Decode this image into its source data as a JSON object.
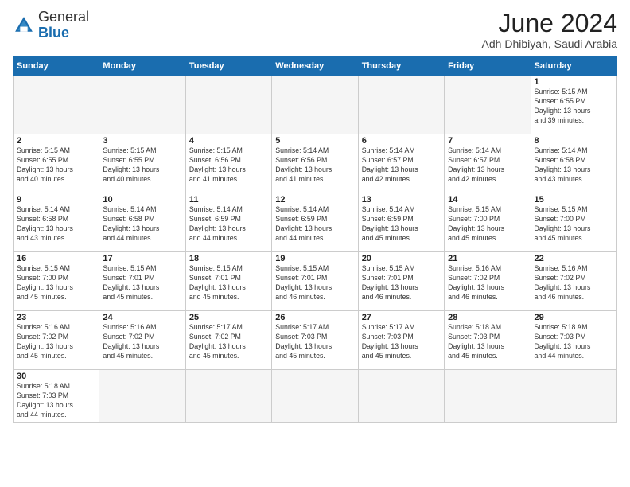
{
  "header": {
    "logo_general": "General",
    "logo_blue": "Blue",
    "month_title": "June 2024",
    "subtitle": "Adh Dhibiyah, Saudi Arabia"
  },
  "weekdays": [
    "Sunday",
    "Monday",
    "Tuesday",
    "Wednesday",
    "Thursday",
    "Friday",
    "Saturday"
  ],
  "days": [
    {
      "date": "",
      "empty": true
    },
    {
      "date": "",
      "empty": true
    },
    {
      "date": "",
      "empty": true
    },
    {
      "date": "",
      "empty": true
    },
    {
      "date": "",
      "empty": true
    },
    {
      "date": "",
      "empty": true
    },
    {
      "date": "1",
      "sunrise": "5:15 AM",
      "sunset": "6:55 PM",
      "daylight": "13 hours and 39 minutes."
    },
    {
      "date": "2",
      "sunrise": "5:15 AM",
      "sunset": "6:55 PM",
      "daylight": "13 hours and 40 minutes."
    },
    {
      "date": "3",
      "sunrise": "5:15 AM",
      "sunset": "6:55 PM",
      "daylight": "13 hours and 40 minutes."
    },
    {
      "date": "4",
      "sunrise": "5:15 AM",
      "sunset": "6:56 PM",
      "daylight": "13 hours and 41 minutes."
    },
    {
      "date": "5",
      "sunrise": "5:14 AM",
      "sunset": "6:56 PM",
      "daylight": "13 hours and 41 minutes."
    },
    {
      "date": "6",
      "sunrise": "5:14 AM",
      "sunset": "6:57 PM",
      "daylight": "13 hours and 42 minutes."
    },
    {
      "date": "7",
      "sunrise": "5:14 AM",
      "sunset": "6:57 PM",
      "daylight": "13 hours and 42 minutes."
    },
    {
      "date": "8",
      "sunrise": "5:14 AM",
      "sunset": "6:58 PM",
      "daylight": "13 hours and 43 minutes."
    },
    {
      "date": "9",
      "sunrise": "5:14 AM",
      "sunset": "6:58 PM",
      "daylight": "13 hours and 43 minutes."
    },
    {
      "date": "10",
      "sunrise": "5:14 AM",
      "sunset": "6:58 PM",
      "daylight": "13 hours and 44 minutes."
    },
    {
      "date": "11",
      "sunrise": "5:14 AM",
      "sunset": "6:59 PM",
      "daylight": "13 hours and 44 minutes."
    },
    {
      "date": "12",
      "sunrise": "5:14 AM",
      "sunset": "6:59 PM",
      "daylight": "13 hours and 44 minutes."
    },
    {
      "date": "13",
      "sunrise": "5:14 AM",
      "sunset": "6:59 PM",
      "daylight": "13 hours and 45 minutes."
    },
    {
      "date": "14",
      "sunrise": "5:15 AM",
      "sunset": "7:00 PM",
      "daylight": "13 hours and 45 minutes."
    },
    {
      "date": "15",
      "sunrise": "5:15 AM",
      "sunset": "7:00 PM",
      "daylight": "13 hours and 45 minutes."
    },
    {
      "date": "16",
      "sunrise": "5:15 AM",
      "sunset": "7:00 PM",
      "daylight": "13 hours and 45 minutes."
    },
    {
      "date": "17",
      "sunrise": "5:15 AM",
      "sunset": "7:01 PM",
      "daylight": "13 hours and 45 minutes."
    },
    {
      "date": "18",
      "sunrise": "5:15 AM",
      "sunset": "7:01 PM",
      "daylight": "13 hours and 45 minutes."
    },
    {
      "date": "19",
      "sunrise": "5:15 AM",
      "sunset": "7:01 PM",
      "daylight": "13 hours and 46 minutes."
    },
    {
      "date": "20",
      "sunrise": "5:15 AM",
      "sunset": "7:01 PM",
      "daylight": "13 hours and 46 minutes."
    },
    {
      "date": "21",
      "sunrise": "5:16 AM",
      "sunset": "7:02 PM",
      "daylight": "13 hours and 46 minutes."
    },
    {
      "date": "22",
      "sunrise": "5:16 AM",
      "sunset": "7:02 PM",
      "daylight": "13 hours and 46 minutes."
    },
    {
      "date": "23",
      "sunrise": "5:16 AM",
      "sunset": "7:02 PM",
      "daylight": "13 hours and 45 minutes."
    },
    {
      "date": "24",
      "sunrise": "5:16 AM",
      "sunset": "7:02 PM",
      "daylight": "13 hours and 45 minutes."
    },
    {
      "date": "25",
      "sunrise": "5:17 AM",
      "sunset": "7:02 PM",
      "daylight": "13 hours and 45 minutes."
    },
    {
      "date": "26",
      "sunrise": "5:17 AM",
      "sunset": "7:03 PM",
      "daylight": "13 hours and 45 minutes."
    },
    {
      "date": "27",
      "sunrise": "5:17 AM",
      "sunset": "7:03 PM",
      "daylight": "13 hours and 45 minutes."
    },
    {
      "date": "28",
      "sunrise": "5:18 AM",
      "sunset": "7:03 PM",
      "daylight": "13 hours and 45 minutes."
    },
    {
      "date": "29",
      "sunrise": "5:18 AM",
      "sunset": "7:03 PM",
      "daylight": "13 hours and 44 minutes."
    },
    {
      "date": "30",
      "sunrise": "5:18 AM",
      "sunset": "7:03 PM",
      "daylight": "13 hours and 44 minutes."
    },
    {
      "date": "",
      "empty": true
    },
    {
      "date": "",
      "empty": true
    },
    {
      "date": "",
      "empty": true
    },
    {
      "date": "",
      "empty": true
    },
    {
      "date": "",
      "empty": true
    },
    {
      "date": "",
      "empty": true
    }
  ],
  "labels": {
    "sunrise": "Sunrise:",
    "sunset": "Sunset:",
    "daylight": "Daylight:"
  }
}
